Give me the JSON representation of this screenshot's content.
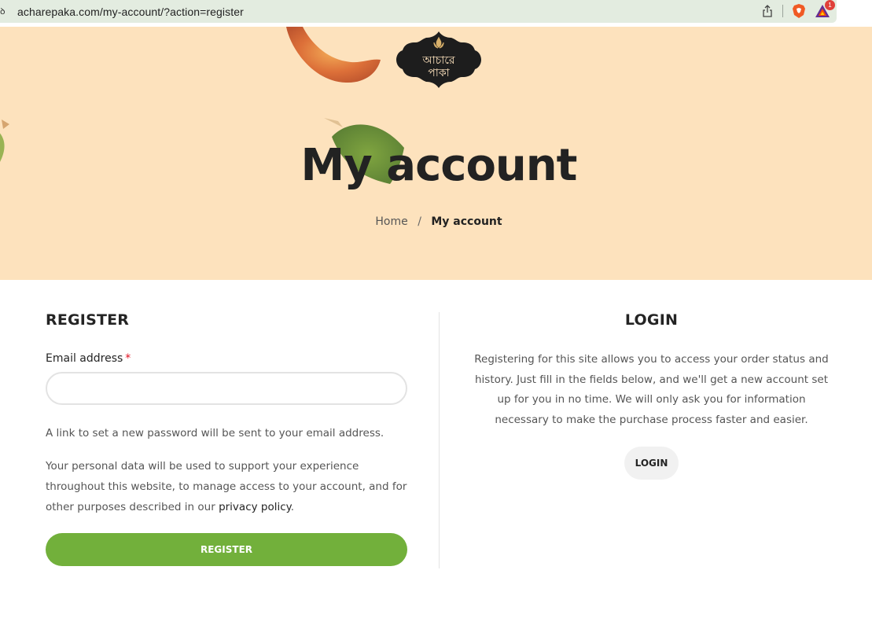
{
  "browser": {
    "url_prefix": "ꝺ",
    "url": "acharepaka.com/my-account/?action=register",
    "icons": [
      "share-icon",
      "brave-shield-icon",
      "bat-rewards-icon"
    ],
    "rewards_badge": "1"
  },
  "hero": {
    "logo_line1": "আচারে",
    "logo_line2": "পাকা",
    "title": "My account",
    "breadcrumb": {
      "home": "Home",
      "separator": "/",
      "current": "My account"
    }
  },
  "register": {
    "heading": "REGISTER",
    "email_label": "Email address",
    "required_mark": "*",
    "email_value": "",
    "password_note": "A link to set a new password will be sent to your email address.",
    "privacy_text": "Your personal data will be used to support your experience throughout this website, to manage access to your account, and for other purposes described in our ",
    "privacy_link": "privacy policy",
    "privacy_end": ".",
    "button": "REGISTER"
  },
  "login": {
    "heading": "LOGIN",
    "intro": "Registering for this site allows you to access your order status and history. Just fill in the fields below, and we'll get a new account set up for you in no time. We will only ask you for information necessary to make the purchase process faster and easier.",
    "button": "LOGIN"
  },
  "colors": {
    "hero_bg": "#fde2bd",
    "register_button": "#72b03b",
    "login_button": "#f1f1f1",
    "required": "#e01020",
    "logo": "#1d1d1d"
  }
}
